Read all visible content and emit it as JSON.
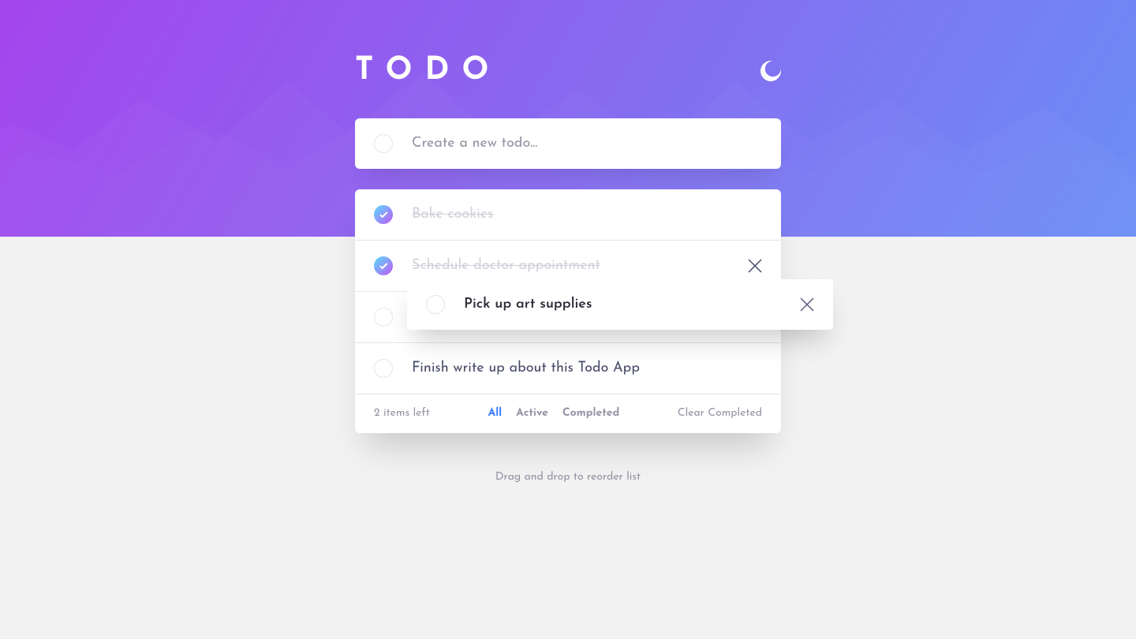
{
  "header": {
    "title": "TODO",
    "theme_icon": "moon-icon"
  },
  "newTodo": {
    "placeholder": "Create a new todo..."
  },
  "todos": [
    {
      "text": "Bake cookies",
      "completed": true,
      "showDelete": false
    },
    {
      "text": "Schedule doctor appointment",
      "completed": true,
      "showDelete": true
    },
    {
      "text": "Pick up art supplies",
      "completed": false,
      "ghost": true,
      "showDelete": false
    },
    {
      "text": "Finish write up about this Todo App",
      "completed": false,
      "showDelete": false
    }
  ],
  "draggingItem": {
    "text": "Pick up art supplies",
    "completed": false
  },
  "footer": {
    "itemsLeft": "2 items left",
    "filters": {
      "all": "All",
      "active": "Active",
      "completed": "Completed"
    },
    "activeFilter": "all",
    "clearCompleted": "Clear Completed"
  },
  "dragHint": "Drag and drop to reorder list"
}
